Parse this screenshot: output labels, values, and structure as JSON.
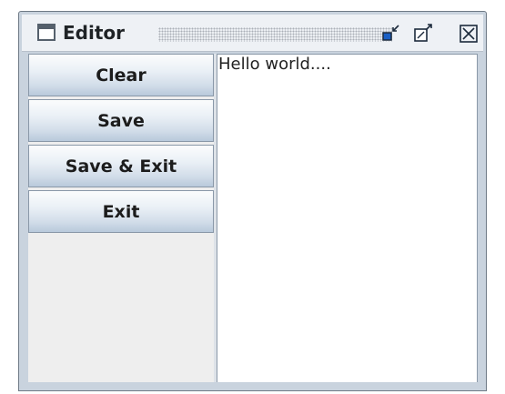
{
  "window": {
    "title": "Editor",
    "icons": {
      "app": "window-icon",
      "iconify": "minimize-icon",
      "maximize": "maximize-icon",
      "close": "close-icon"
    }
  },
  "sidebar": {
    "buttons": [
      {
        "label": "Clear"
      },
      {
        "label": "Save"
      },
      {
        "label": "Save & Exit"
      },
      {
        "label": "Exit"
      }
    ]
  },
  "editor": {
    "text": "Hello world...."
  },
  "colors": {
    "titlebar_bg": "#eef1f5",
    "button_gradient_top": "#fbfcfd",
    "button_gradient_bottom": "#b8c9db",
    "frame": "#c9d3de",
    "icon_blue": "#1a5fc4"
  }
}
